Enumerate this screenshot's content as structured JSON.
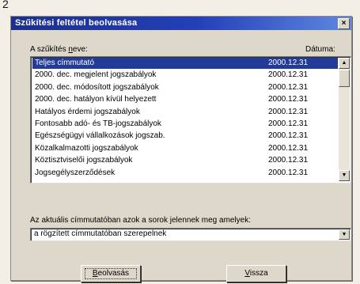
{
  "page_number": "2",
  "window": {
    "title": "Szűkítési feltétel beolvasása",
    "close_glyph": "×"
  },
  "list": {
    "name_header": "A szűkítés neve:",
    "name_header_underlined": "n",
    "date_header": "Dátuma:",
    "rows": [
      {
        "name": "Teljes címmutató",
        "date": "2000.12.31",
        "selected": true
      },
      {
        "name": "2000. dec. megjelent jogszabályok",
        "date": "2000.12.31"
      },
      {
        "name": "2000. dec. módosított jogszabályok",
        "date": "2000.12.31"
      },
      {
        "name": "2000. dec. hatályon kívül helyezett",
        "date": "2000.12.31"
      },
      {
        "name": "Hatályos érdemi jogszabályok",
        "date": "2000.12.31"
      },
      {
        "name": "Fontosabb adó- és TB-jogszabályok",
        "date": "2000.12.31"
      },
      {
        "name": "Egészségügyi vállalkozások jogszab.",
        "date": "2000.12.31"
      },
      {
        "name": "Közalkalmazotti jogszabályok",
        "date": "2000.12.31"
      },
      {
        "name": "Köztisztviselői jogszabályok",
        "date": "2000.12.31"
      },
      {
        "name": "Jogsegélyszerződések",
        "date": "2000.12.31"
      }
    ]
  },
  "filter": {
    "label": "Az aktuális címmutatóban azok a sorok jelennek meg amelyek:",
    "selected": "a rögzített címmutatóban szerepelnek"
  },
  "buttons": {
    "read": "Beolvasás",
    "back": "Vissza"
  },
  "icons": {
    "scroll_up": "▲",
    "scroll_down": "▼",
    "dropdown": "▼"
  },
  "colors": {
    "title_bar": "#2440b8",
    "selection": "#223a99",
    "dialog_bg": "#ddd8ca"
  }
}
